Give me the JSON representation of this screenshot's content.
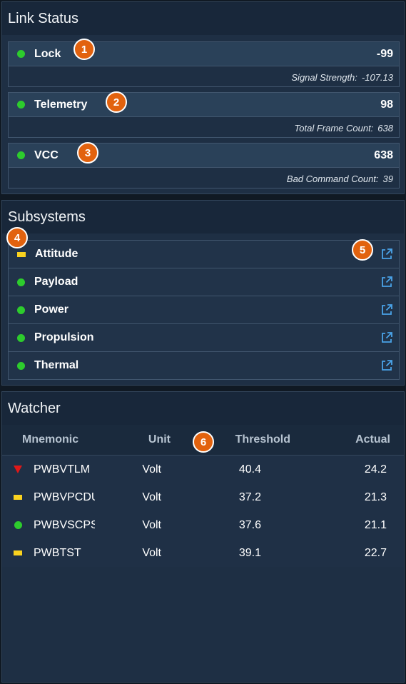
{
  "link_status": {
    "title": "Link Status",
    "items": [
      {
        "label": "Lock",
        "value": "-99",
        "detail_label": "Signal Strength:",
        "detail_value": "-107.13"
      },
      {
        "label": "Telemetry",
        "value": "98",
        "detail_label": "Total Frame Count:",
        "detail_value": "638"
      },
      {
        "label": "VCC",
        "value": "638",
        "detail_label": "Bad Command Count:",
        "detail_value": "39"
      }
    ]
  },
  "subsystems": {
    "title": "Subsystems",
    "items": [
      {
        "label": "Attitude",
        "status": "caution"
      },
      {
        "label": "Payload",
        "status": "normal"
      },
      {
        "label": "Power",
        "status": "normal"
      },
      {
        "label": "Propulsion",
        "status": "normal"
      },
      {
        "label": "Thermal",
        "status": "normal"
      }
    ]
  },
  "watcher": {
    "title": "Watcher",
    "columns": {
      "mnemonic": "Mnemonic",
      "unit": "Unit",
      "threshold": "Threshold",
      "actual": "Actual"
    },
    "rows": [
      {
        "status": "critical",
        "mnemonic": "PWBVTLM",
        "unit": "Volt",
        "threshold": "40.4",
        "actual": "24.2"
      },
      {
        "status": "caution",
        "mnemonic": "PWBVPCDU",
        "unit": "Volt",
        "threshold": "37.2",
        "actual": "21.3"
      },
      {
        "status": "normal",
        "mnemonic": "PWBVSCPST",
        "unit": "Volt",
        "threshold": "37.6",
        "actual": "21.1"
      },
      {
        "status": "caution",
        "mnemonic": "PWBTST",
        "unit": "Volt",
        "threshold": "39.1",
        "actual": "22.7"
      }
    ]
  },
  "callouts": [
    "1",
    "2",
    "3",
    "4",
    "5",
    "6"
  ],
  "colors": {
    "normal": "#2dcc2d",
    "caution": "#f9d21f",
    "critical": "#e01818",
    "callout": "#e2620e",
    "link": "#4aa3e8"
  }
}
